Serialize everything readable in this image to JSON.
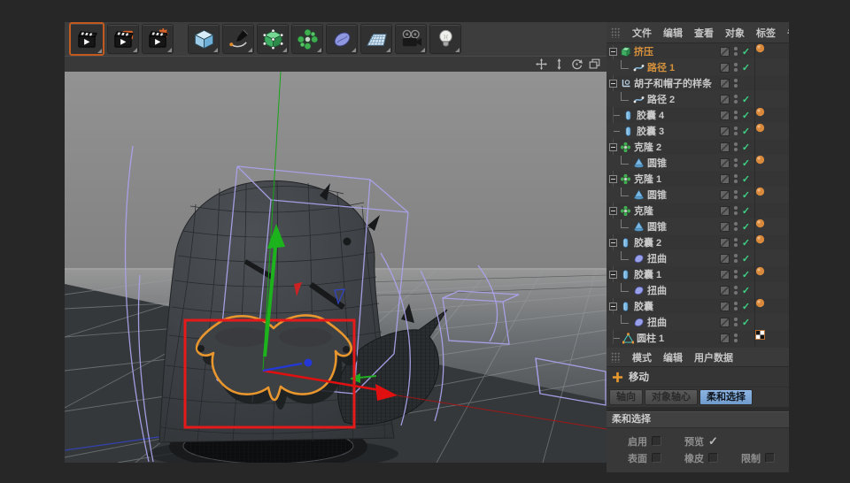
{
  "colors": {
    "accent_orange": "#d6913c",
    "check_green": "#3ed184",
    "tab_active_blue": "#7fa8d9",
    "selection_red": "#e61a1a",
    "gizmo_green": "#1db31d",
    "gizmo_red": "#e01010",
    "gizmo_blue": "#2438d8",
    "spline_purple": "#aaa2ea",
    "mustache_outline": "#e8962e"
  },
  "toolbar": {
    "render_buttons": [
      {
        "name": "render-active-view",
        "icon": "clapper-play-icon",
        "selected": true
      },
      {
        "name": "render-picture-viewer",
        "icon": "clapper-picture-icon",
        "selected": false
      },
      {
        "name": "render-settings",
        "icon": "clapper-gear-icon",
        "selected": false
      }
    ],
    "tool_buttons": [
      {
        "name": "add-primitive-cube",
        "icon": "cube-icon"
      },
      {
        "name": "draw-spline-pen",
        "icon": "pen-icon"
      },
      {
        "name": "add-generator",
        "icon": "green-cube-icon"
      },
      {
        "name": "add-cloner",
        "icon": "cloner-flower-icon"
      },
      {
        "name": "add-deformer",
        "icon": "deformer-icon"
      },
      {
        "name": "add-floor-environment",
        "icon": "floor-grid-icon"
      },
      {
        "name": "add-camera",
        "icon": "camera-icon"
      },
      {
        "name": "add-light",
        "icon": "light-bulb-icon"
      }
    ]
  },
  "viewport": {
    "nav_icons": [
      {
        "name": "pan-view-icon",
        "glyph": "pan"
      },
      {
        "name": "zoom-view-icon",
        "glyph": "zoom"
      },
      {
        "name": "rotate-view-icon",
        "glyph": "rotate"
      },
      {
        "name": "toggle-view-icon",
        "glyph": "maximize"
      }
    ],
    "scene_objects": [
      "extrude-mustache",
      "capsule-body",
      "horn",
      "base-cylinder",
      "move-gizmo",
      "selection-rectangle"
    ]
  },
  "object_manager": {
    "menu": [
      "文件",
      "编辑",
      "查看",
      "对象",
      "标签",
      "书签"
    ],
    "rows": [
      {
        "label": "挤压",
        "icon": "extrude",
        "depth": 0,
        "expander": true,
        "selected": true,
        "check": "on",
        "tags": [
          "orange",
          "orange"
        ]
      },
      {
        "label": "路径 1",
        "icon": "spline",
        "depth": 1,
        "expander": false,
        "selected": true,
        "check": "on",
        "tags": []
      },
      {
        "label": "胡子和帽子的样条",
        "icon": "null",
        "depth": 0,
        "expander": true,
        "selected": false,
        "check": "none",
        "tags": []
      },
      {
        "label": "路径 2",
        "icon": "spline",
        "depth": 1,
        "expander": false,
        "selected": false,
        "check": "on",
        "tags": []
      },
      {
        "label": "胶囊 4",
        "icon": "capsule",
        "depth": 0,
        "expander": false,
        "selected": false,
        "check": "on",
        "tags": [
          "orange",
          "orange"
        ]
      },
      {
        "label": "胶囊 3",
        "icon": "capsule",
        "depth": 0,
        "expander": false,
        "selected": false,
        "check": "on",
        "tags": [
          "orange",
          "orange"
        ]
      },
      {
        "label": "克隆 2",
        "icon": "cloner",
        "depth": 0,
        "expander": true,
        "selected": false,
        "check": "on",
        "tags": []
      },
      {
        "label": "圆锥",
        "icon": "cone",
        "depth": 1,
        "expander": false,
        "selected": false,
        "check": "on",
        "tags": [
          "orange",
          "orange"
        ]
      },
      {
        "label": "克隆 1",
        "icon": "cloner",
        "depth": 0,
        "expander": true,
        "selected": false,
        "check": "on",
        "tags": []
      },
      {
        "label": "圆锥",
        "icon": "cone",
        "depth": 1,
        "expander": false,
        "selected": false,
        "check": "on",
        "tags": [
          "orange",
          "orange"
        ]
      },
      {
        "label": "克隆",
        "icon": "cloner",
        "depth": 0,
        "expander": true,
        "selected": false,
        "check": "on",
        "tags": []
      },
      {
        "label": "圆锥",
        "icon": "cone",
        "depth": 1,
        "expander": false,
        "selected": false,
        "check": "on",
        "tags": [
          "orange",
          "orange"
        ]
      },
      {
        "label": "胶囊 2",
        "icon": "capsule",
        "depth": 0,
        "expander": true,
        "selected": false,
        "check": "on",
        "tags": [
          "orange",
          "orange"
        ]
      },
      {
        "label": "扭曲",
        "icon": "bend",
        "depth": 1,
        "expander": false,
        "selected": false,
        "check": "on",
        "tags": []
      },
      {
        "label": "胶囊 1",
        "icon": "capsule",
        "depth": 0,
        "expander": true,
        "selected": false,
        "check": "on",
        "tags": [
          "orange",
          "orange"
        ]
      },
      {
        "label": "扭曲",
        "icon": "bend",
        "depth": 1,
        "expander": false,
        "selected": false,
        "check": "on",
        "tags": []
      },
      {
        "label": "胶囊",
        "icon": "capsule",
        "depth": 0,
        "expander": true,
        "selected": false,
        "check": "on",
        "tags": [
          "orange",
          "orange"
        ]
      },
      {
        "label": "扭曲",
        "icon": "bend",
        "depth": 1,
        "expander": false,
        "selected": false,
        "check": "on",
        "tags": []
      },
      {
        "label": "圆柱 1",
        "icon": "polymesh",
        "depth": 0,
        "expander": false,
        "selected": false,
        "check": "none",
        "tags": [
          "orange",
          "texture"
        ]
      }
    ]
  },
  "attribute_manager": {
    "menu": [
      "模式",
      "编辑",
      "用户数据"
    ],
    "tool": {
      "label": "移动",
      "icon": "move-plus-icon"
    },
    "tabs": [
      {
        "label": "轴向",
        "active": false
      },
      {
        "label": "对象轴心",
        "active": false
      },
      {
        "label": "柔和选择",
        "active": true
      }
    ],
    "section": {
      "title": "柔和选择",
      "rows": [
        [
          {
            "label": "启用",
            "checked": false
          },
          {
            "label": "预览",
            "checked": true
          }
        ],
        [
          {
            "label": "表面",
            "checked": false
          },
          {
            "label": "橡皮",
            "checked": false
          },
          {
            "label": "限制",
            "checked": false
          }
        ]
      ]
    }
  }
}
